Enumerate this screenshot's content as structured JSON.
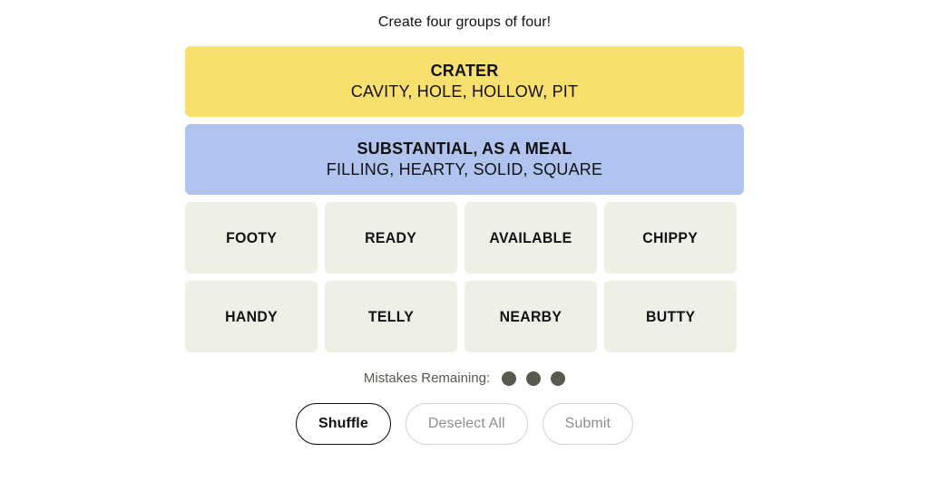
{
  "instruction": "Create four groups of four!",
  "colors": {
    "yellow": "#f9df6d",
    "blue": "#b0c4ef",
    "tile": "#efefe6",
    "dot": "#5a594e",
    "text": "#121212",
    "disabled_text": "#8e8e8e",
    "disabled_border": "#d3d3d3",
    "page_background": "#ffffff"
  },
  "solved_groups": [
    {
      "title": "CRATER",
      "members": "CAVITY, HOLE, HOLLOW, PIT",
      "color": "#f9df6d"
    },
    {
      "title": "SUBSTANTIAL, AS A MEAL",
      "members": "FILLING, HEARTY, SOLID, SQUARE",
      "color": "#b0c4ef"
    }
  ],
  "tile_rows": [
    [
      {
        "label": "FOOTY"
      },
      {
        "label": "READY"
      },
      {
        "label": "AVAILABLE"
      },
      {
        "label": "CHIPPY"
      }
    ],
    [
      {
        "label": "HANDY"
      },
      {
        "label": "TELLY"
      },
      {
        "label": "NEARBY"
      },
      {
        "label": "BUTTY"
      }
    ]
  ],
  "mistakes": {
    "label": "Mistakes Remaining:",
    "remaining": 3
  },
  "buttons": [
    {
      "label": "Shuffle",
      "state": "enabled"
    },
    {
      "label": "Deselect All",
      "state": "disabled"
    },
    {
      "label": "Submit",
      "state": "disabled"
    }
  ]
}
